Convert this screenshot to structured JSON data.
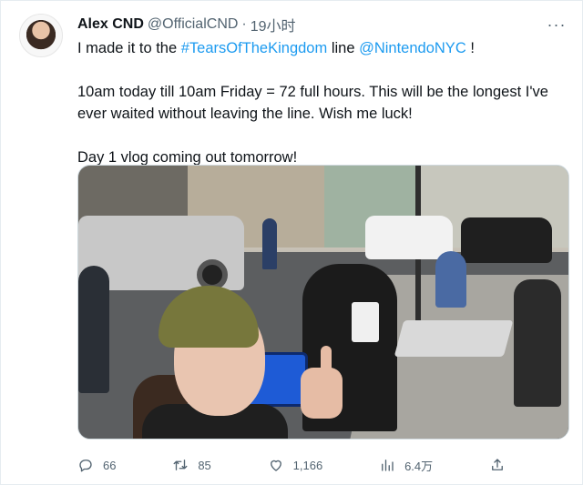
{
  "header": {
    "name": "Alex CND",
    "handle": "@OfficialCND",
    "separator": "·",
    "time": "19小时"
  },
  "more_icon": "more-horizontal-icon",
  "body": {
    "line1_prefix": "I made it to the ",
    "hashtag": "#TearsOfTheKingdom",
    "line1_middle": " line ",
    "mention": "@NintendoNYC",
    "line1_suffix": " !",
    "line2": "10am today till 10am Friday = 72 full hours. This will be the longest I've ever waited without leaving the line. Wish me luck!",
    "line3": "Day 1 vlog coming out tomorrow!"
  },
  "actions": {
    "reply_count": "66",
    "retweet_count": "85",
    "like_count": "1,166",
    "views_count": "6.4万"
  },
  "colors": {
    "link": "#1d9bf0",
    "muted": "#536471",
    "text": "#0f1419"
  }
}
